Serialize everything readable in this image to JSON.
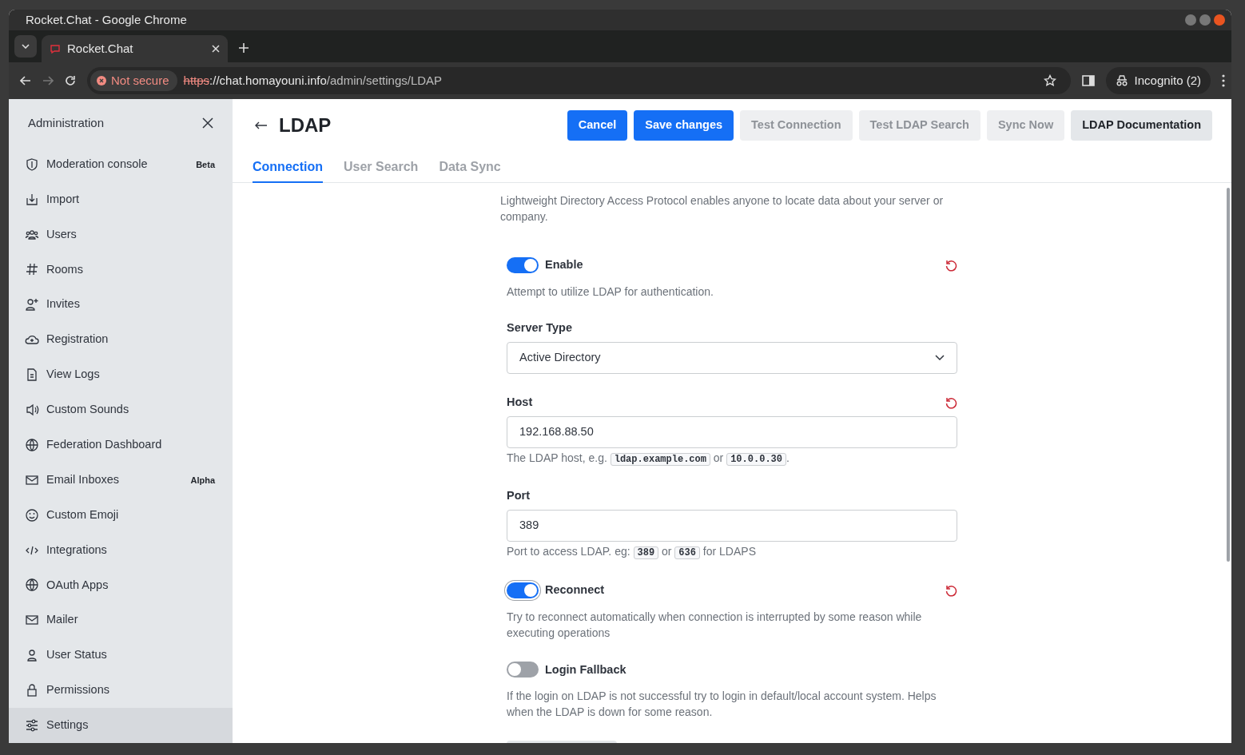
{
  "window": {
    "title": "Rocket.Chat - Google Chrome"
  },
  "browser": {
    "tab_title": "Rocket.Chat",
    "security": "Not secure",
    "url": {
      "scheme": "https",
      "host": "://chat.homayouni.info",
      "path": "/admin/settings/LDAP"
    },
    "profile": "Incognito (2)"
  },
  "sidebar": {
    "title": "Administration",
    "items": [
      {
        "label": "Moderation console",
        "badge": "Beta",
        "selected": false
      },
      {
        "label": "Import",
        "selected": false
      },
      {
        "label": "Users",
        "selected": false
      },
      {
        "label": "Rooms",
        "selected": false
      },
      {
        "label": "Invites",
        "selected": false
      },
      {
        "label": "Registration",
        "selected": false
      },
      {
        "label": "View Logs",
        "selected": false
      },
      {
        "label": "Custom Sounds",
        "selected": false
      },
      {
        "label": "Federation Dashboard",
        "selected": false
      },
      {
        "label": "Email Inboxes",
        "badge": "Alpha",
        "selected": false
      },
      {
        "label": "Custom Emoji",
        "selected": false
      },
      {
        "label": "Integrations",
        "selected": false
      },
      {
        "label": "OAuth Apps",
        "selected": false
      },
      {
        "label": "Mailer",
        "selected": false
      },
      {
        "label": "User Status",
        "selected": false
      },
      {
        "label": "Permissions",
        "selected": false
      },
      {
        "label": "Settings",
        "selected": true
      }
    ]
  },
  "page": {
    "title": "LDAP",
    "buttons": [
      {
        "label": "Cancel",
        "kind": "primary"
      },
      {
        "label": "Save changes",
        "kind": "primary"
      },
      {
        "label": "Test Connection",
        "kind": "disabled"
      },
      {
        "label": "Test LDAP Search",
        "kind": "disabled"
      },
      {
        "label": "Sync Now",
        "kind": "disabled"
      },
      {
        "label": "LDAP Documentation",
        "kind": "secondary"
      }
    ],
    "tabs": [
      {
        "label": "Connection",
        "selected": true
      },
      {
        "label": "User Search",
        "selected": false
      },
      {
        "label": "Data Sync",
        "selected": false
      }
    ],
    "intro": "Lightweight Directory Access Protocol enables anyone to locate data about your server or company.",
    "settings": [
      {
        "kind": "toggle",
        "label": "Enable",
        "on": true,
        "focused": false,
        "resettable": true,
        "help": [
          {
            "text": "Attempt to utilize LDAP for authentication."
          }
        ]
      },
      {
        "kind": "select",
        "label": "Server Type",
        "value": "Active Directory",
        "resettable": false
      },
      {
        "kind": "text",
        "label": "Host",
        "value": "192.168.88.50",
        "resettable": true,
        "help": [
          {
            "text": "The LDAP host, e.g. "
          },
          {
            "code": "ldap.example.com"
          },
          {
            "text": " or "
          },
          {
            "code": "10.0.0.30"
          },
          {
            "text": "."
          }
        ]
      },
      {
        "kind": "text",
        "label": "Port",
        "value": "389",
        "resettable": false,
        "help": [
          {
            "text": "Port to access LDAP. eg: "
          },
          {
            "code": "389"
          },
          {
            "text": " or "
          },
          {
            "code": "636"
          },
          {
            "text": " for LDAPS"
          }
        ]
      },
      {
        "kind": "toggle",
        "label": "Reconnect",
        "on": true,
        "focused": true,
        "resettable": true,
        "help": [
          {
            "text": "Try to reconnect automatically when connection is interrupted by some reason while executing operations"
          }
        ]
      },
      {
        "kind": "toggle",
        "label": "Login Fallback",
        "on": false,
        "focused": false,
        "resettable": false,
        "help": [
          {
            "text": "If the login on LDAP is not successful try to login in default/local account system. Helps when the LDAP is down for some reason."
          }
        ]
      },
      {
        "kind": "button"
      }
    ]
  }
}
